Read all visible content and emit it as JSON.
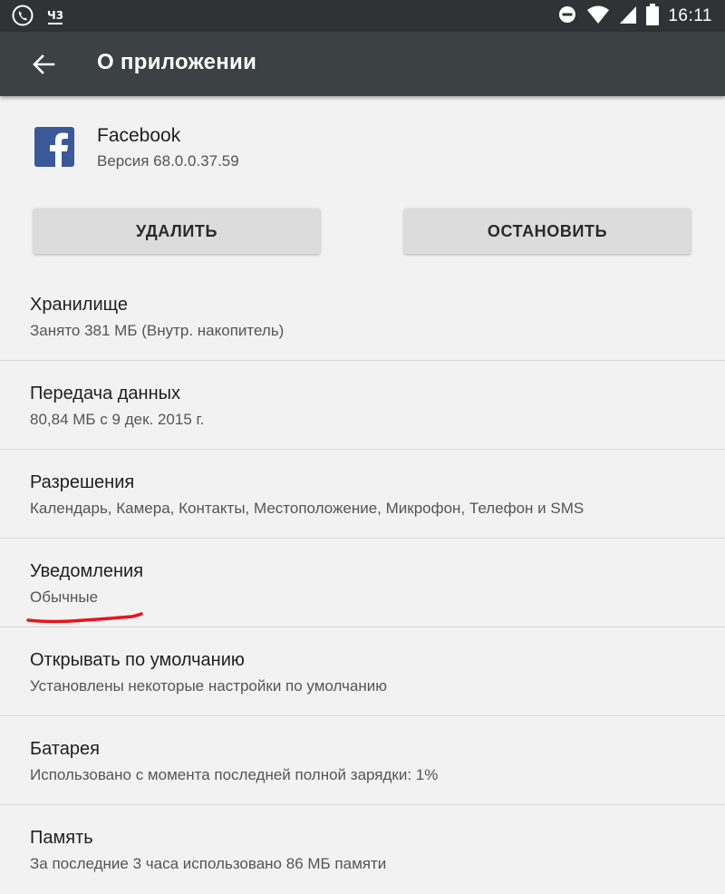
{
  "status_bar": {
    "icons": [
      "viber-icon",
      "notification-badge-icon",
      "do-not-disturb-icon",
      "wifi-icon",
      "signal-icon",
      "battery-icon"
    ],
    "notif_text": "Ч3",
    "time": "16:11"
  },
  "app_bar": {
    "back_icon": "arrow-back-icon",
    "title": "О приложении"
  },
  "app": {
    "name": "Facebook",
    "version": "Версия 68.0.0.37.59",
    "icon": "facebook-icon",
    "brand_color": "#3b5998"
  },
  "buttons": {
    "uninstall": "УДАЛИТЬ",
    "stop": "ОСТАНОВИТЬ"
  },
  "items": [
    {
      "title": "Хранилище",
      "subtitle": "Занято 381 МБ (Внутр. накопитель)"
    },
    {
      "title": "Передача данных",
      "subtitle": "80,84 МБ с 9 дек. 2015 г."
    },
    {
      "title": "Разрешения",
      "subtitle": "Календарь, Камера, Контакты, Местоположение, Микрофон, Телефон и SMS"
    },
    {
      "title": "Уведомления",
      "subtitle": "Обычные"
    },
    {
      "title": "Открывать по умолчанию",
      "subtitle": "Установлены некоторые настройки по умолчанию"
    },
    {
      "title": "Батарея",
      "subtitle": "Использовано с момента последней полной зарядки: 1%"
    },
    {
      "title": "Память",
      "subtitle": "За последние 3 часа использовано 86 МБ памяти"
    }
  ],
  "annotation_color": "#e8141c"
}
